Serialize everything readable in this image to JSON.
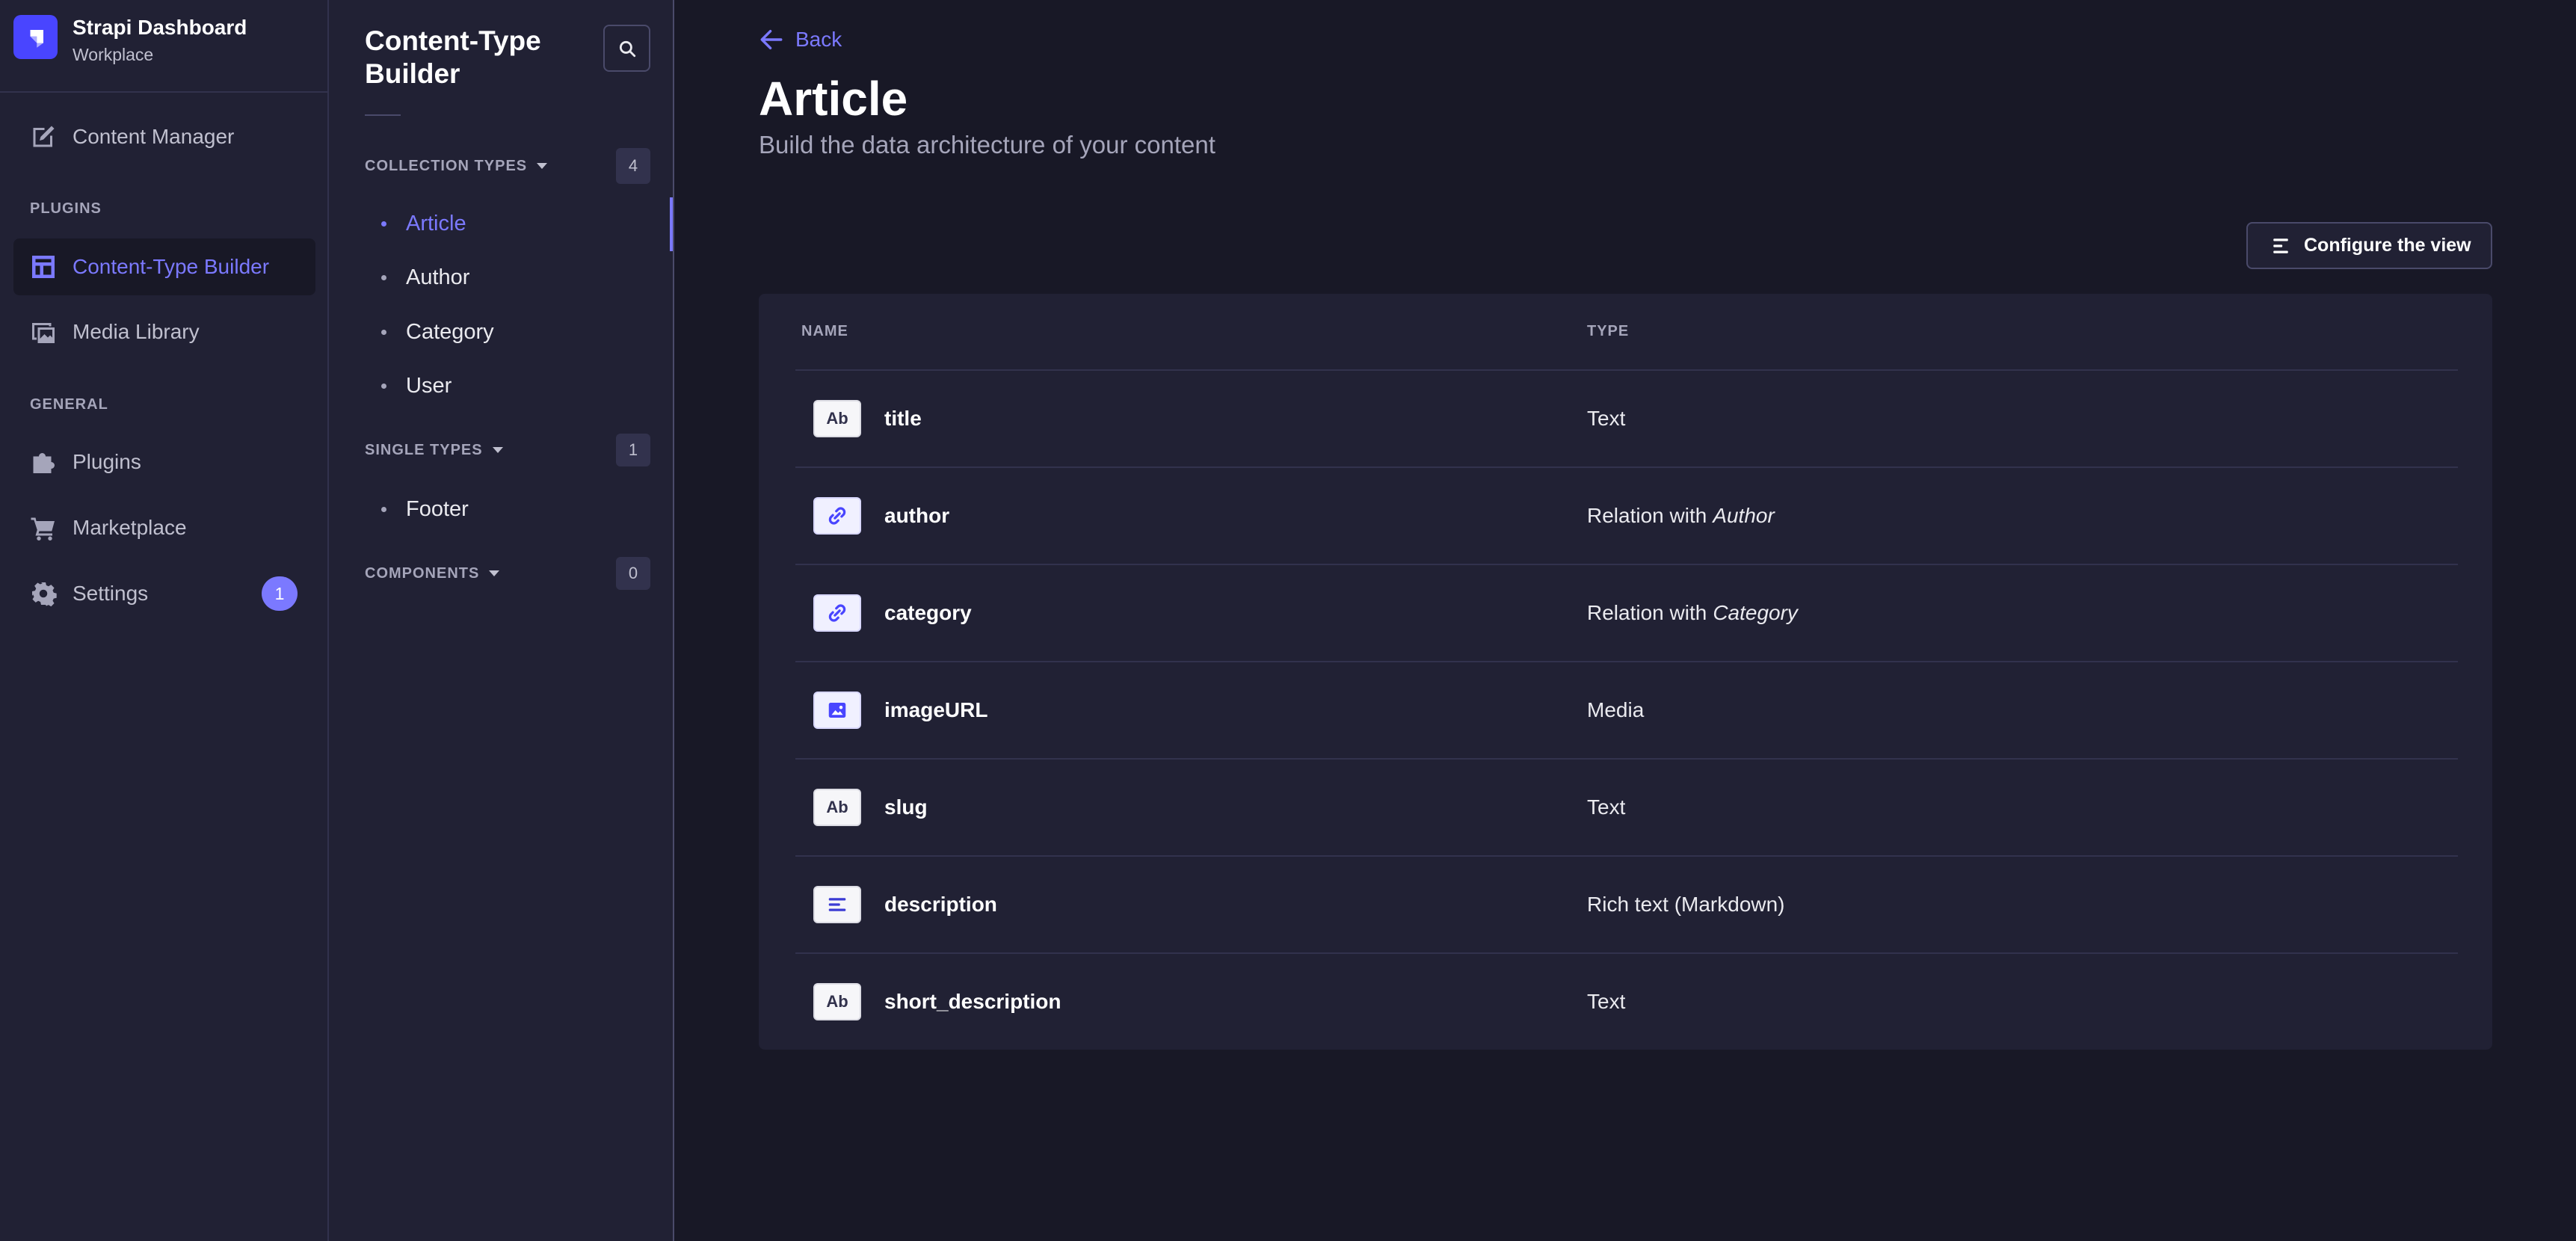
{
  "colors": {
    "accent": "#7b79ff",
    "background": "#181826",
    "surface": "#212134",
    "border": "#32324d",
    "logo": "#4945ff"
  },
  "brand": {
    "title": "Strapi Dashboard",
    "subtitle": "Workplace",
    "icon": "strapi-logo"
  },
  "main_nav": {
    "top_items": [
      {
        "label": "Content Manager",
        "icon": "pencil-icon"
      }
    ],
    "plugins_heading": "PLUGINS",
    "plugin_items": [
      {
        "label": "Content-Type Builder",
        "icon": "layout-icon",
        "active": true
      },
      {
        "label": "Media Library",
        "icon": "images-icon",
        "active": false
      }
    ],
    "general_heading": "GENERAL",
    "general_items": [
      {
        "label": "Plugins",
        "icon": "puzzle-icon"
      },
      {
        "label": "Marketplace",
        "icon": "cart-icon"
      },
      {
        "label": "Settings",
        "icon": "gear-icon",
        "badge": "1"
      }
    ]
  },
  "sub_nav": {
    "title": "Content-Type Builder",
    "search_icon": "search-icon",
    "sections": [
      {
        "label": "COLLECTION TYPES",
        "count": "4",
        "items": [
          {
            "label": "Article",
            "active": true
          },
          {
            "label": "Author"
          },
          {
            "label": "Category"
          },
          {
            "label": "User"
          }
        ]
      },
      {
        "label": "SINGLE TYPES",
        "count": "1",
        "items": [
          {
            "label": "Footer"
          }
        ]
      },
      {
        "label": "COMPONENTS",
        "count": "0",
        "items": []
      }
    ]
  },
  "header": {
    "back_label": "Back",
    "title": "Article",
    "subtitle": "Build the data architecture of your content",
    "configure_label": "Configure the view"
  },
  "table": {
    "columns": [
      "NAME",
      "TYPE"
    ],
    "rows": [
      {
        "icon": "text-icon",
        "icon_text": "Ab",
        "name": "title",
        "type": "Text"
      },
      {
        "icon": "relation-icon",
        "name": "author",
        "type": "Relation with",
        "type_target": "Author"
      },
      {
        "icon": "relation-icon",
        "name": "category",
        "type": "Relation with",
        "type_target": "Category"
      },
      {
        "icon": "media-icon",
        "name": "imageURL",
        "type": "Media"
      },
      {
        "icon": "text-icon",
        "icon_text": "Ab",
        "name": "slug",
        "type": "Text"
      },
      {
        "icon": "richtext-icon",
        "name": "description",
        "type": "Rich text (Markdown)"
      },
      {
        "icon": "text-icon",
        "icon_text": "Ab",
        "name": "short_description",
        "type": "Text"
      }
    ]
  }
}
